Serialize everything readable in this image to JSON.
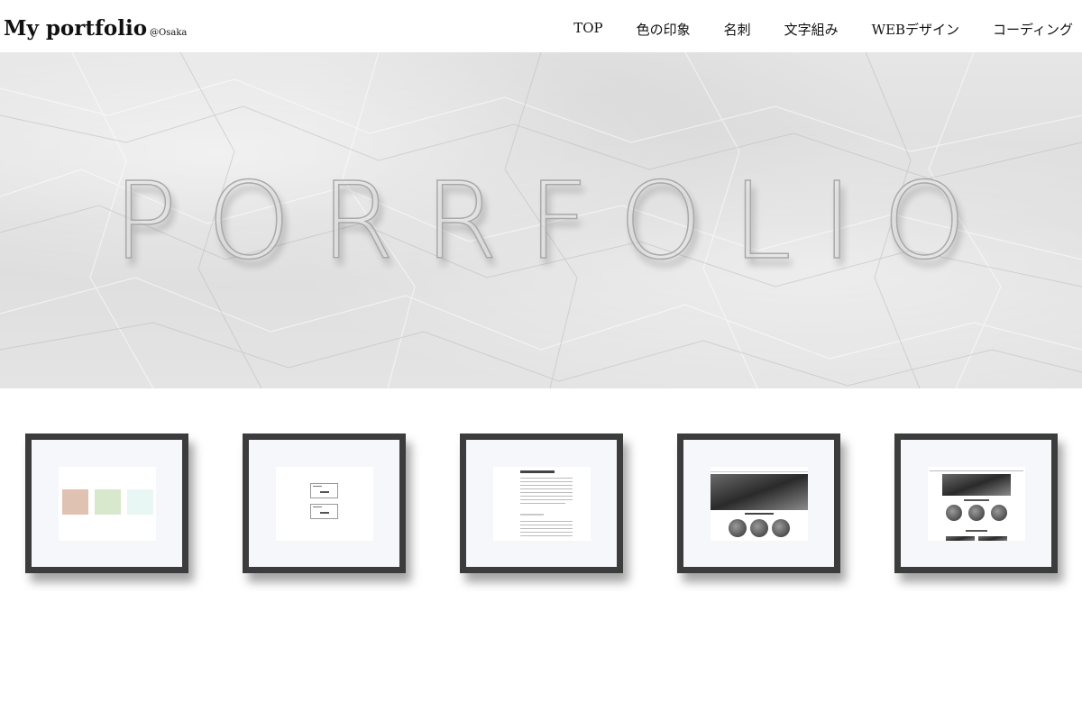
{
  "header": {
    "logo": "My portfolio",
    "logo_sub": "@Osaka",
    "nav": [
      {
        "label": "TOP"
      },
      {
        "label": "色の印象"
      },
      {
        "label": "名刺"
      },
      {
        "label": "文字組み"
      },
      {
        "label": "WEBデザイン"
      },
      {
        "label": "コーディング"
      }
    ]
  },
  "hero": {
    "title": "PORRFOLIO"
  },
  "gallery": {
    "items": [
      {
        "name": "color-impression",
        "colors": [
          "#e0c2b2",
          "#d8e8cc",
          "#e8f7f4"
        ]
      },
      {
        "name": "business-card"
      },
      {
        "name": "text-layout"
      },
      {
        "name": "web-design"
      },
      {
        "name": "coding"
      }
    ]
  },
  "colors": {
    "frame": "#3c3c3c",
    "mat": "#f5f7fb",
    "hero_bg": "#e0e0e0"
  }
}
